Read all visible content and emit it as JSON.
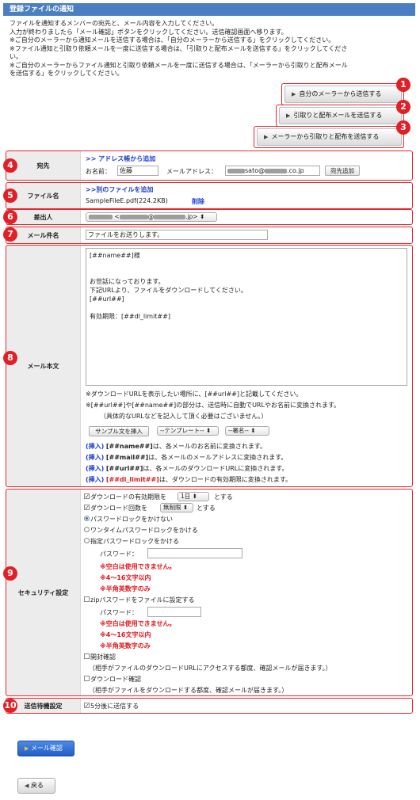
{
  "page_title": "登録ファイルの通知",
  "intro_lines": [
    "ファイルを通知するメンバーの宛先と、メール内容を入力してください。",
    "入力が終わりましたら「メール確認」ボタンをクリックしてください。送信確認画面へ移ります。",
    "※ご自分のメーラーから通知メールを送信する場合は、「自分のメーラーから送信する」をクリックしてください。",
    "※ファイル通知と引取り依頼メールを一度に送信する場合は、「引取りと配布メールを送信する」をクリックしてくださ",
    "い。",
    "※ご自分のメーラーからファイル通知と引取り依頼メールを一度に送信する場合は、「メーラーから引取りと配布メール",
    "を送信する」をクリックしてください。"
  ],
  "buttons": {
    "own_mailer": "自分のメーラーから送信する",
    "pickup_distribute": "引取りと配布メールを送信する",
    "mailer_pickup_distribute": "メーラーから引取りと配布を送信する",
    "mail_confirm": "メール確認",
    "back": "戻る",
    "add_recipient": "宛先追加",
    "insert_sample": "サンプル文を挿入"
  },
  "markers": [
    "1",
    "2",
    "3",
    "4",
    "5",
    "6",
    "7",
    "8",
    "9",
    "10"
  ],
  "recipient": {
    "label": "宛先",
    "address_book_link": ">> アドレス帳から追加",
    "name_label": "お名前：",
    "name_value": "佐藤",
    "email_label": "メールアドレス：",
    "email_value_visible": "sato@",
    "email_suffix": ".co.jp"
  },
  "file": {
    "label": "ファイル名",
    "add_link": ">>別のファイルを追加",
    "file_name": "SampleFileE.pdf(224.2KB)",
    "delete": "削除"
  },
  "sender": {
    "label": "差出人",
    "value_visible": "<",
    "value_mid": "@",
    "value_suffix": ".jp>"
  },
  "subject": {
    "label": "メール件名",
    "value": "ファイルをお送りします。"
  },
  "body": {
    "label": "メール本文",
    "text": "[##name##]様\n\n\nお世話になっております。\n下記URLより、ファイルをダウンロードしてください。\n[##url##]\n\n有効期限：[##dl_limit##]",
    "note1": "※ダウンロードURLを表示したい場所に、[##url##]と記載してください。",
    "note2": "※[##url##]や[##name##]の部分は、送信時に自動でURLやお名前に変換されます。",
    "note3": "（具体的なURLなどを記入して頂く必要はございません。）",
    "template_select": "--テンプレート--",
    "signature_select": "--署名--",
    "insert_label": "(挿入)",
    "inserts": [
      {
        "tag": "[##name##]",
        "desc": "は、各メールのお名前に変換されます。"
      },
      {
        "tag": "[##mail##]",
        "desc": "は、各メールのメールアドレスに変換されます。"
      },
      {
        "tag": "[##url##]",
        "desc": "は、各メールのダウンロードURLに変換されます。"
      },
      {
        "tag": "[##dl_limit##]",
        "desc": "は、ダウンロードの有効期限に変換されます。"
      }
    ]
  },
  "security": {
    "label": "セキュリティ設定",
    "dl_limit_pre": "ダウンロードの有効期限を",
    "dl_limit_value": "1日",
    "dl_limit_post": "とする",
    "dl_count_pre": "ダウンロード回数を",
    "dl_count_value": "無制限",
    "dl_count_post": "とする",
    "opt_no_lock": "パスワードロックをかけない",
    "opt_onetime": "ワンタイムパスワードロックをかける",
    "opt_specified": "指定パスワードロックをかける",
    "password_label": "パスワード：",
    "rule1": "※空白は使用できません。",
    "rule2": "※4〜16文字以内",
    "rule3": "※半角英数字のみ",
    "zip_label": "zipパスワードをファイルに設定する",
    "open_confirm": "開封確認",
    "open_confirm_note": "（相手がファイルのダウンロードURLにアクセスする都度、確認メールが届きます。）",
    "dl_confirm": "ダウンロード確認",
    "dl_confirm_note": "（相手がファイルをダウンロードする都度、確認メールが届きます。）"
  },
  "wait": {
    "label": "送信待機設定",
    "value": "5分後に送信する"
  },
  "colors": {
    "header_blue": "#4a7fc1",
    "marker_red": "#e21f26",
    "link_blue": "#1a3fd1",
    "confirm_blue": "#2f6fd6"
  }
}
